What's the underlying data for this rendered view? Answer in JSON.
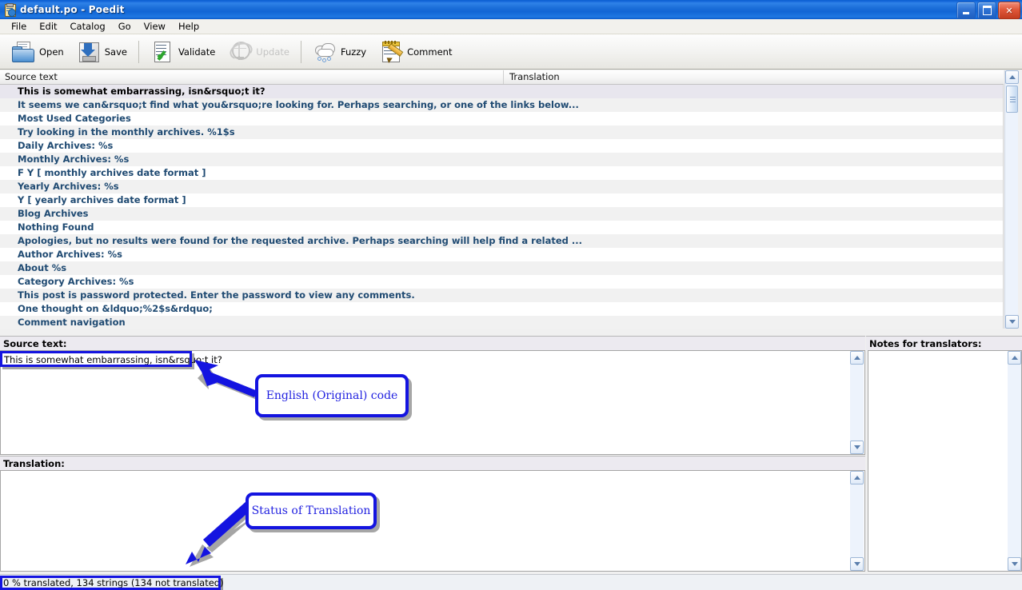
{
  "window": {
    "title": "default.po - Poedit",
    "icon": "poedit-icon",
    "buttons": {
      "minimize": "–",
      "maximize": "❐",
      "close": "✕"
    }
  },
  "menu": {
    "items": [
      "File",
      "Edit",
      "Catalog",
      "Go",
      "View",
      "Help"
    ]
  },
  "toolbar": {
    "items": [
      {
        "label": "Open",
        "icon": "open-folder-icon",
        "disabled": false
      },
      {
        "label": "Save",
        "icon": "save-disk-icon",
        "disabled": false
      },
      {
        "label": "Validate",
        "icon": "validate-check-icon",
        "disabled": false
      },
      {
        "label": "Update",
        "icon": "update-globe-icon",
        "disabled": true
      },
      {
        "label": "Fuzzy",
        "icon": "fuzzy-clouds-icon",
        "disabled": false
      },
      {
        "label": "Comment",
        "icon": "comment-notepad-icon",
        "disabled": false
      }
    ]
  },
  "list": {
    "columns": [
      "Source text",
      "Translation"
    ],
    "rows": [
      "This is somewhat embarrassing, isn&rsquo;t it?",
      "It seems we can&rsquo;t find what you&rsquo;re looking for. Perhaps searching, or one of the links below...",
      "Most Used Categories",
      "Try looking in the monthly archives. %1$s",
      "Daily Archives: %s",
      "Monthly Archives: %s",
      "F Y  [ monthly archives date format ]",
      "Yearly Archives: %s",
      "Y  [ yearly archives date format ]",
      "Blog Archives",
      "Nothing Found",
      "Apologies, but no results were found for the requested archive. Perhaps searching will help find a related ...",
      "Author Archives: %s",
      "About %s",
      "Category Archives: %s",
      "This post is password protected. Enter the password to view any comments.",
      "One thought on &ldquo;%2$s&rdquo;",
      "Comment navigation"
    ],
    "selected_index": 0
  },
  "panes": {
    "source_label": "Source text:",
    "source_value": "This is somewhat embarrassing, isn&rsquo;t it?",
    "translation_label": "Translation:",
    "translation_value": "",
    "notes_label": "Notes for translators:",
    "notes_value": ""
  },
  "statusbar": {
    "text": "0 % translated, 134 strings (134 not translated)"
  },
  "annotations": {
    "callout_source": "English (Original) code",
    "callout_status": "Status of Translation",
    "accent_color": "#1414e0"
  }
}
